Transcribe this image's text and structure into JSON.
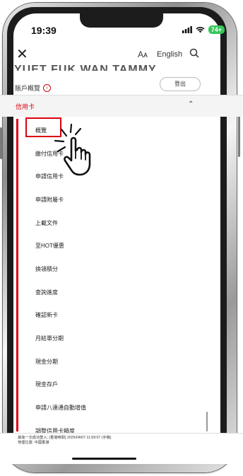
{
  "status_bar": {
    "time": "19:39",
    "battery": "74+"
  },
  "header": {
    "font_size_label": "Aᴀ",
    "language_label": "English",
    "name_cut": "YUET FUK WAN TAMMY",
    "overview_link": "賬戶概覽",
    "logout_label": "登出"
  },
  "section": {
    "title": "信用卡"
  },
  "menu": {
    "items": [
      "概覽",
      "繳付信用卡",
      "申請信用卡",
      "申請附屬卡",
      "上載文件",
      "至HOT優惠",
      "換領積分",
      "查詢進度",
      "確認新卡",
      "月結單分期",
      "現金分期",
      "現金存戶",
      "申請八達通自動增值",
      "調整信用卡額度"
    ],
    "active_index": 0
  },
  "footer": {
    "last_login": "最後一次成功登入: (香港時間) 2025/04/07 11:59:07 (手機)",
    "location": "地理位置: 中國香港"
  },
  "colors": {
    "accent": "#db0011",
    "battery": "#35c759"
  },
  "icons": [
    "close-icon",
    "search-icon",
    "chevron-up-icon",
    "arrow-right-circle-icon",
    "pointing-hand-icon"
  ]
}
